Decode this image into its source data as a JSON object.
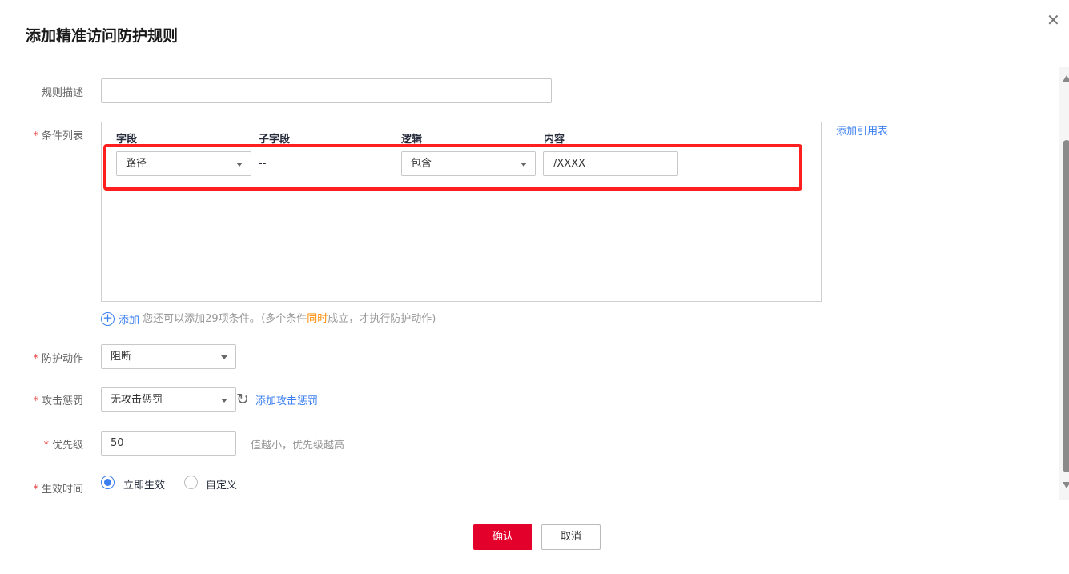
{
  "dialog": {
    "title": "添加精准访问防护规则",
    "close_icon": "close-icon"
  },
  "form": {
    "description": {
      "label": "规则描述",
      "value": ""
    },
    "conditions": {
      "label": "条件列表",
      "headers": [
        "字段",
        "子字段",
        "逻辑",
        "内容"
      ],
      "rows": [
        {
          "field": "路径",
          "subfield": "--",
          "logic": "包含",
          "content": "/XXXX"
        }
      ],
      "add_ref_table": "添加引用表",
      "add_label": "添加",
      "hint_prefix": "您还可以添加29项条件。（多个条件",
      "hint_highlight": "同时",
      "hint_suffix": "成立，才执行防护动作)",
      "highlight_color": "#ff8a00"
    },
    "action": {
      "label": "防护动作",
      "value": "阻断"
    },
    "penalty": {
      "label": "攻击惩罚",
      "value": "无攻击惩罚",
      "add_link": "添加攻击惩罚"
    },
    "priority": {
      "label": "优先级",
      "value": "50",
      "hint": "值越小，优先级越高"
    },
    "effective": {
      "label": "生效时间",
      "options": [
        "立即生效",
        "自定义"
      ],
      "selected": "立即生效"
    }
  },
  "footer": {
    "confirm": "确认",
    "cancel": "取消"
  },
  "colors": {
    "primary": "#e3002a",
    "link": "#3b7ff0",
    "highlight_box": "#ff1f1f"
  }
}
